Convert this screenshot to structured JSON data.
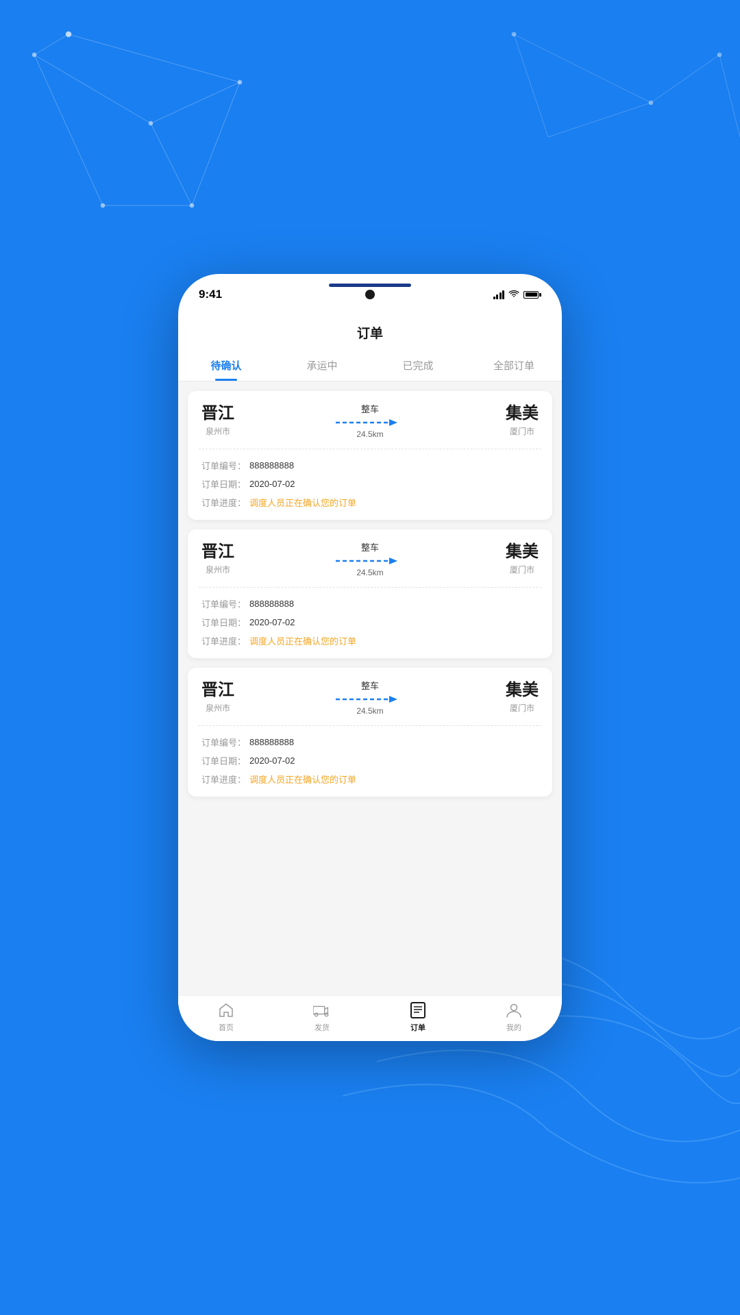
{
  "background": {
    "color": "#1a7ff0"
  },
  "status_bar": {
    "time": "9:41"
  },
  "header": {
    "title": "订单"
  },
  "tabs": [
    {
      "id": "pending",
      "label": "待确认",
      "active": true
    },
    {
      "id": "transit",
      "label": "承运中",
      "active": false
    },
    {
      "id": "done",
      "label": "已完成",
      "active": false
    },
    {
      "id": "all",
      "label": "全部订单",
      "active": false
    }
  ],
  "orders": [
    {
      "from_city": "晋江",
      "from_sub": "泉州市",
      "to_city": "集美",
      "to_sub": "厦门市",
      "route_type": "整车",
      "distance": "24.5km",
      "order_no_label": "订单编号：",
      "order_no": "888888888",
      "order_date_label": "订单日期：",
      "order_date": "2020-07-02",
      "order_progress_label": "订单进度：",
      "order_progress": "调度人员正在确认您的订单"
    },
    {
      "from_city": "晋江",
      "from_sub": "泉州市",
      "to_city": "集美",
      "to_sub": "厦门市",
      "route_type": "整车",
      "distance": "24.5km",
      "order_no_label": "订单编号：",
      "order_no": "888888888",
      "order_date_label": "订单日期：",
      "order_date": "2020-07-02",
      "order_progress_label": "订单进度：",
      "order_progress": "调度人员正在确认您的订单"
    },
    {
      "from_city": "晋江",
      "from_sub": "泉州市",
      "to_city": "集美",
      "to_sub": "厦门市",
      "route_type": "整车",
      "distance": "24.5km",
      "order_no_label": "订单编号：",
      "order_no": "888888888",
      "order_date_label": "订单日期：",
      "order_date": "2020-07-02",
      "order_progress_label": "订单进度：",
      "order_progress": "调度人员正在确认您的订单"
    }
  ],
  "bottom_nav": [
    {
      "id": "home",
      "label": "首页",
      "active": false
    },
    {
      "id": "ship",
      "label": "发货",
      "active": false
    },
    {
      "id": "order",
      "label": "订单",
      "active": true
    },
    {
      "id": "mine",
      "label": "我的",
      "active": false
    }
  ]
}
